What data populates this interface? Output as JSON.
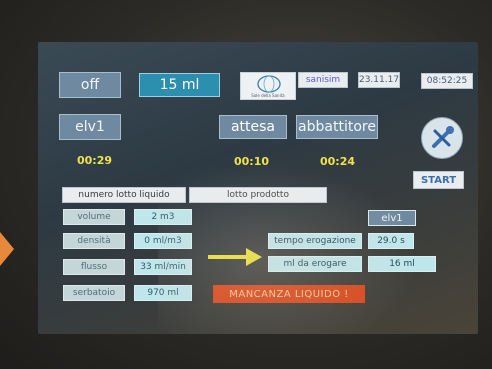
{
  "top": {
    "off_label": "off",
    "dose_label": "15 ml",
    "logo_caption": "Sole della Sanità",
    "brand": "sanisim",
    "date": "23.11.17",
    "time": "08:52:25"
  },
  "row2": {
    "elv_label": "elv1",
    "attesa_label": "attesa",
    "abbattitore_label": "abbattitore"
  },
  "timers": {
    "t1": "00:29",
    "t2": "00:10",
    "t3": "00:24"
  },
  "start_label": "START",
  "lot": {
    "liquid_label": "numero lotto liquido",
    "product_label": "lotto prodotto"
  },
  "params": [
    {
      "label": "volume",
      "value": "2 m3"
    },
    {
      "label": "densità",
      "value": "0 ml/m3"
    },
    {
      "label": "flusso",
      "value": "33 ml/min"
    },
    {
      "label": "serbatoio",
      "value": "970 ml"
    }
  ],
  "right": {
    "elv_label": "elv1",
    "tempo_label": "tempo erogazione",
    "tempo_value": "29.0 s",
    "ml_label": "ml da erogare",
    "ml_value": "16 ml"
  },
  "alarm": "MANCANZA LIQUIDO !",
  "colors": {
    "accent_teal": "#2d8fb0",
    "alarm_red": "#d64a1e",
    "timer_yellow": "#f0e24a",
    "arrow_yellow": "#e8e03a"
  }
}
